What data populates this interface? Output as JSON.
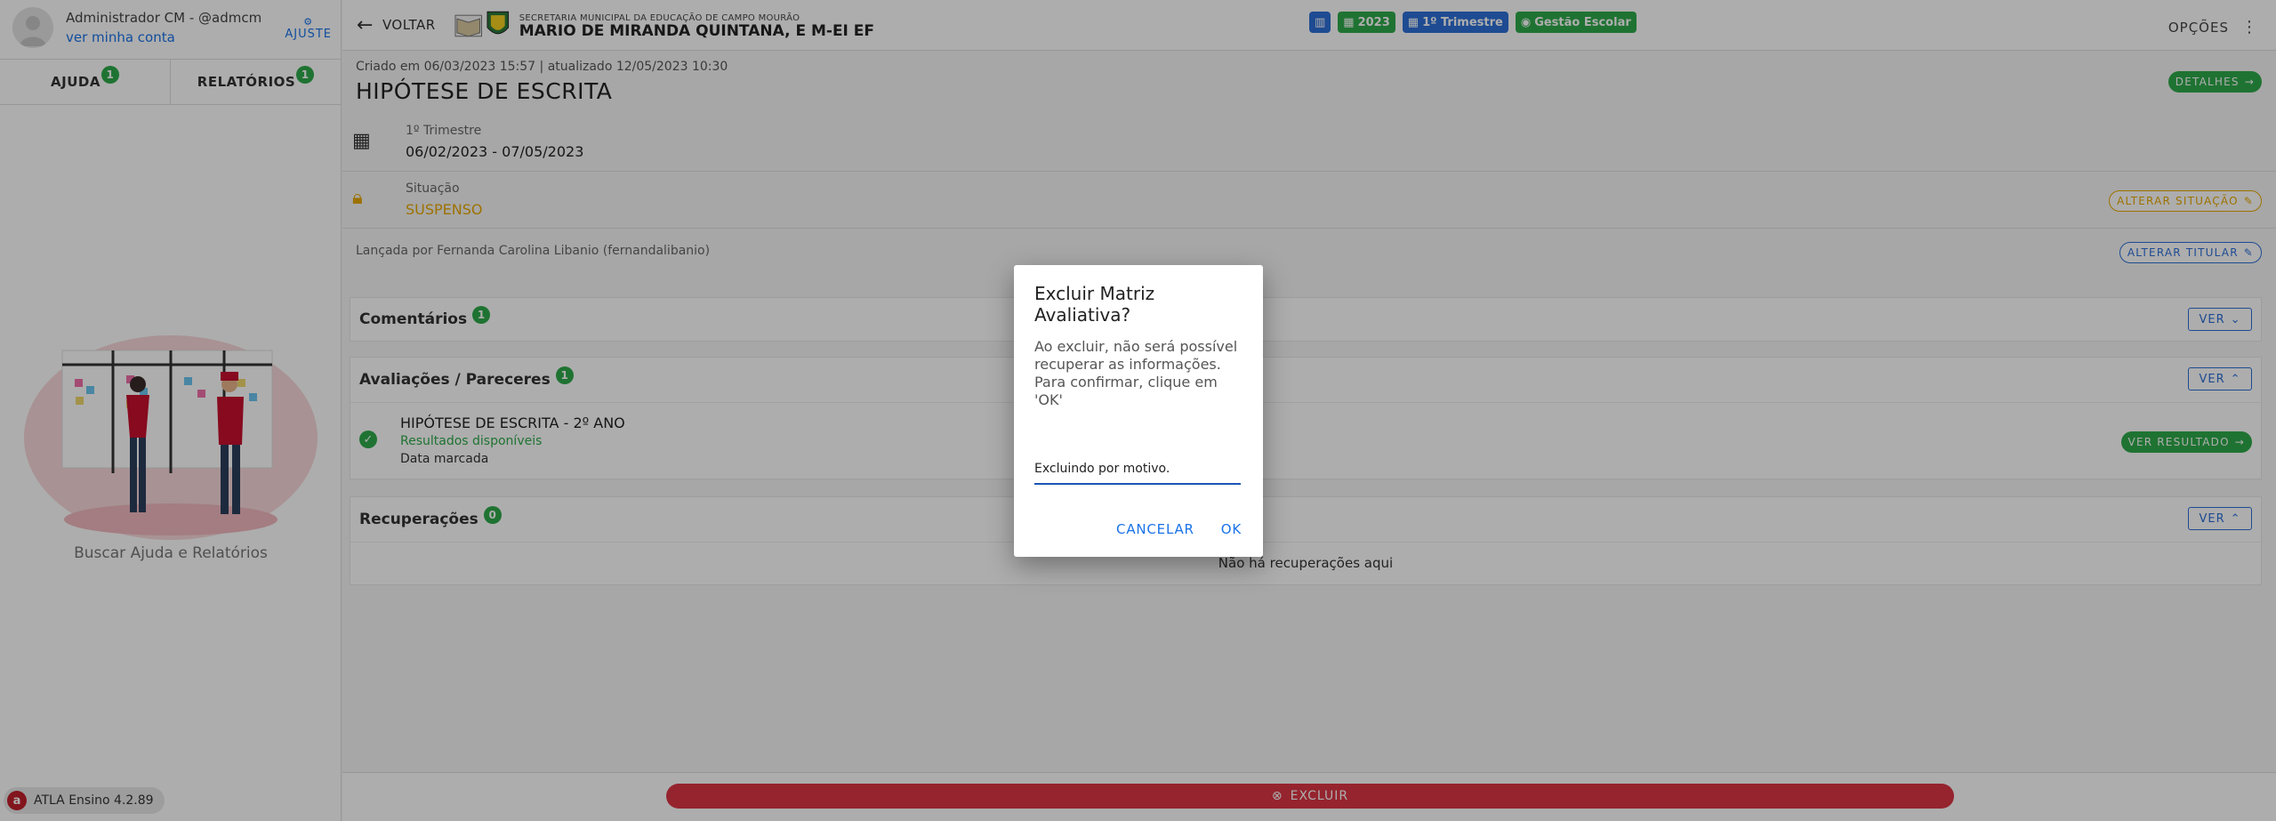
{
  "user": {
    "name": "Administrador CM - @admcm",
    "account_link": "ver minha conta",
    "settings_label": "AJUSTE"
  },
  "sidebar": {
    "tabs": [
      {
        "label": "AJUDA",
        "count": "1"
      },
      {
        "label": "RELATÓRIOS",
        "count": "1"
      }
    ],
    "help_caption": "Buscar Ajuda e Relatórios",
    "version": "ATLA Ensino 4.2.89"
  },
  "header": {
    "back_label": "VOLTAR",
    "school_subtitle": "SECRETARIA MUNICIPAL DA EDUCAÇÃO DE CAMPO MOURÃO",
    "school_name": "MARIO DE MIRANDA QUINTANA, E M-EI EF",
    "chips": [
      "2023",
      "1º Trimestre",
      "Gestão Escolar"
    ],
    "options_label": "OPÇÕES"
  },
  "record": {
    "meta": "Criado em 06/03/2023 15:57 | atualizado 12/05/2023 10:30",
    "title": "HIPÓTESE DE ESCRITA",
    "details_label": "DETALHES",
    "period_label": "1º Trimestre",
    "period_value": "06/02/2023 - 07/05/2023",
    "status_label": "Situação",
    "status_value": "SUSPENSO",
    "change_status_label": "ALTERAR SITUAÇÃO",
    "launched_by": "Lançada por Fernanda Carolina Libanio (fernandalibanio)",
    "change_holder_label": "ALTERAR TITULAR"
  },
  "sections": {
    "comments": {
      "title": "Comentários",
      "count": "1",
      "button": "VER"
    },
    "evaluations": {
      "title": "Avaliações / Pareceres",
      "count": "1",
      "button": "VER",
      "item_title": "HIPÓTESE DE ESCRITA - 2º ANO",
      "item_status": "Resultados disponíveis",
      "item_date": "Data marcada",
      "result_button": "VER RESULTADO"
    },
    "recoveries": {
      "title": "Recuperações",
      "count": "0",
      "button": "VER",
      "empty": "Não há recuperações aqui"
    }
  },
  "footer": {
    "exclude_label": "EXCLUIR"
  },
  "dialog": {
    "title": "Excluir Matriz Avaliativa?",
    "message": "Ao excluir, não será possível recuperar as informações. Para confirmar, clique em 'OK'",
    "input_value": "Excluindo por motivo.",
    "cancel_label": "CANCELAR",
    "ok_label": "OK"
  },
  "colors": {
    "accent_blue": "#2d6fd8",
    "accent_green": "#2eaa4a",
    "warning_yellow": "#e8a800",
    "danger_red": "#dc3545"
  }
}
